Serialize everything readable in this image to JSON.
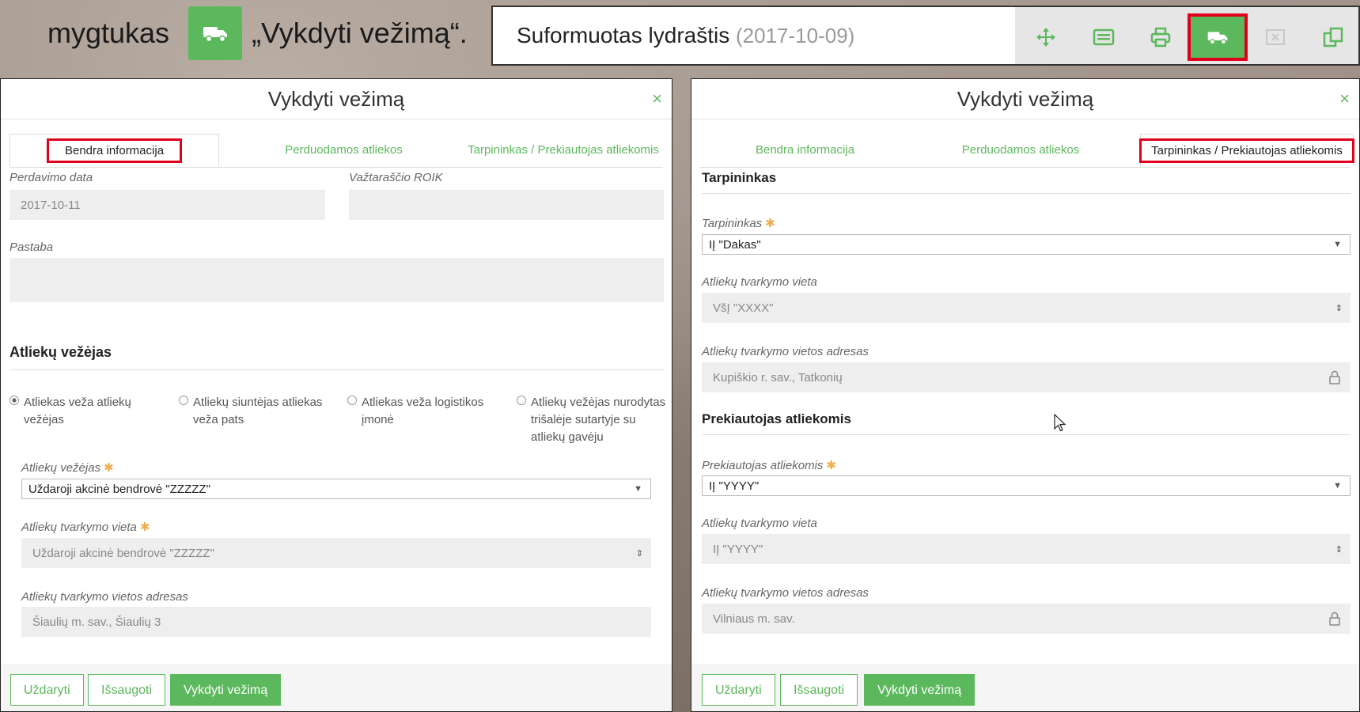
{
  "colors": {
    "accent": "#5cb85c",
    "highlight": "#e0001b",
    "required": "#f0ad4e"
  },
  "instruction": {
    "prefix": "mygtukas",
    "button_icon": "truck-icon",
    "quote": "„Vykdyti vežimą“."
  },
  "doc_toolbar": {
    "title": "Suformuotas lydraštis",
    "date": "(2017-10-09)",
    "tools": [
      "move-icon",
      "list-icon",
      "print-icon",
      "truck-icon",
      "cancel-icon",
      "copy-icon"
    ],
    "active_tool": "truck-icon"
  },
  "dialog_left": {
    "title": "Vykdyti vežimą",
    "close": "×",
    "tabs": [
      "Bendra informacija",
      "Perduodamos atliekos",
      "Tarpininkas / Prekiautojas atliekomis"
    ],
    "active_tab": "Bendra informacija",
    "fields": {
      "transfer_date_label": "Perdavimo data",
      "transfer_date_value": "2017-10-11",
      "roik_label": "Važtaraščio ROIK",
      "roik_value": "",
      "note_label": "Pastaba",
      "note_value": ""
    },
    "carrier_section": "Atliekų vežėjas",
    "radios": [
      "Atliekas veža atliekų vežėjas",
      "Atliekų siuntėjas atliekas veža pats",
      "Atliekas veža logistikos įmonė",
      "Atliekų vežėjas nurodytas trišalėje sutartyje su atliekų gavėju"
    ],
    "selected_radio": 0,
    "carrier_label": "Atliekų vežėjas",
    "carrier_value": "Uždaroji akcinė bendrovė \"ZZZZZ\"",
    "site_label": "Atliekų tvarkymo vieta",
    "site_value": "Uždaroji akcinė bendrovė \"ZZZZZ\"",
    "address_label": "Atliekų tvarkymo vietos adresas",
    "address_value": "Šiaulių m. sav., Šiaulių 3",
    "buttons": {
      "close": "Uždaryti",
      "save": "Išsaugoti",
      "execute": "Vykdyti vežimą"
    }
  },
  "dialog_right": {
    "title": "Vykdyti vežimą",
    "close": "×",
    "tabs": [
      "Bendra informacija",
      "Perduodamos atliekos",
      "Tarpininkas / Prekiautojas atliekomis"
    ],
    "active_tab": "Tarpininkas / Prekiautojas atliekomis",
    "broker_section": "Tarpininkas",
    "broker_label": "Tarpininkas",
    "broker_value": "IĮ \"Dakas\"",
    "broker_site_label": "Atliekų tvarkymo vieta",
    "broker_site_value": "VšĮ \"XXXX\"",
    "broker_address_label": "Atliekų tvarkymo vietos adresas",
    "broker_address_value": "Kupiškio r. sav., Tatkonių",
    "dealer_section": "Prekiautojas atliekomis",
    "dealer_label": "Prekiautojas atliekomis",
    "dealer_value": "IĮ \"YYYY\"",
    "dealer_site_label": "Atliekų tvarkymo vieta",
    "dealer_site_value": "IĮ \"YYYY\"",
    "dealer_address_label": "Atliekų tvarkymo vietos adresas",
    "dealer_address_value": "Vilniaus m. sav.",
    "buttons": {
      "close": "Uždaryti",
      "save": "Išsaugoti",
      "execute": "Vykdyti vežimą"
    }
  }
}
